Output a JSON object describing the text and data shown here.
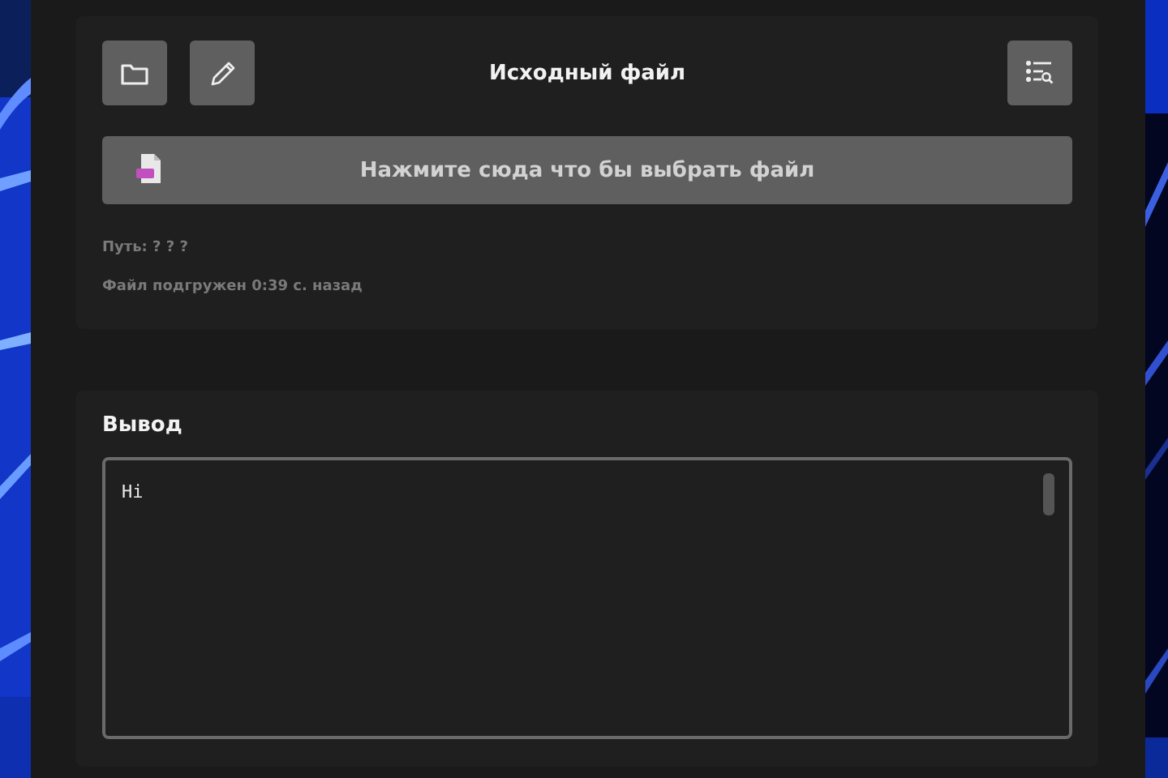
{
  "source_panel": {
    "title": "Исходный файл",
    "pick_file_button": "Нажмите сюда что бы выбрать файл",
    "path": "Путь: ? ? ?",
    "loaded_info": "Файл подгружен 0:39 с. назад"
  },
  "output_panel": {
    "title": "Вывод",
    "value": "Hi"
  }
}
